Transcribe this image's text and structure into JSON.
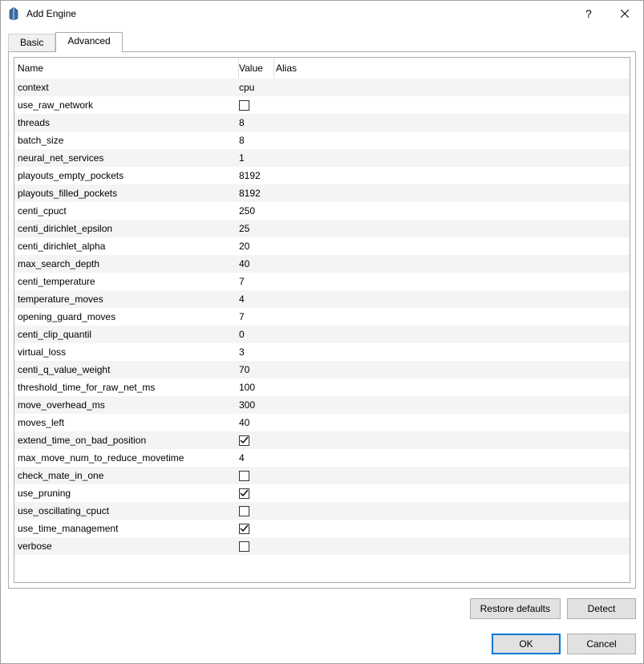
{
  "window": {
    "title": "Add Engine"
  },
  "tabs": {
    "basic": "Basic",
    "advanced": "Advanced"
  },
  "columns": {
    "name": "Name",
    "value": "Value",
    "alias": "Alias"
  },
  "rows": [
    {
      "name": "context",
      "type": "text",
      "value": "cpu"
    },
    {
      "name": "use_raw_network",
      "type": "bool",
      "value": false
    },
    {
      "name": "threads",
      "type": "text",
      "value": "8"
    },
    {
      "name": "batch_size",
      "type": "text",
      "value": "8"
    },
    {
      "name": "neural_net_services",
      "type": "text",
      "value": "1"
    },
    {
      "name": "playouts_empty_pockets",
      "type": "text",
      "value": "8192"
    },
    {
      "name": "playouts_filled_pockets",
      "type": "text",
      "value": "8192"
    },
    {
      "name": "centi_cpuct",
      "type": "text",
      "value": "250"
    },
    {
      "name": "centi_dirichlet_epsilon",
      "type": "text",
      "value": "25"
    },
    {
      "name": "centi_dirichlet_alpha",
      "type": "text",
      "value": "20"
    },
    {
      "name": "max_search_depth",
      "type": "text",
      "value": "40"
    },
    {
      "name": "centi_temperature",
      "type": "text",
      "value": "7"
    },
    {
      "name": "temperature_moves",
      "type": "text",
      "value": "4"
    },
    {
      "name": "opening_guard_moves",
      "type": "text",
      "value": "7"
    },
    {
      "name": "centi_clip_quantil",
      "type": "text",
      "value": "0"
    },
    {
      "name": "virtual_loss",
      "type": "text",
      "value": "3"
    },
    {
      "name": "centi_q_value_weight",
      "type": "text",
      "value": "70"
    },
    {
      "name": "threshold_time_for_raw_net_ms",
      "type": "text",
      "value": "100"
    },
    {
      "name": "move_overhead_ms",
      "type": "text",
      "value": "300"
    },
    {
      "name": "moves_left",
      "type": "text",
      "value": "40"
    },
    {
      "name": "extend_time_on_bad_position",
      "type": "bool",
      "value": true
    },
    {
      "name": "max_move_num_to_reduce_movetime",
      "type": "text",
      "value": "4"
    },
    {
      "name": "check_mate_in_one",
      "type": "bool",
      "value": false
    },
    {
      "name": "use_pruning",
      "type": "bool",
      "value": true
    },
    {
      "name": "use_oscillating_cpuct",
      "type": "bool",
      "value": false
    },
    {
      "name": "use_time_management",
      "type": "bool",
      "value": true
    },
    {
      "name": "verbose",
      "type": "bool",
      "value": false
    }
  ],
  "buttons": {
    "restore_defaults": "Restore defaults",
    "detect": "Detect",
    "ok": "OK",
    "cancel": "Cancel"
  }
}
